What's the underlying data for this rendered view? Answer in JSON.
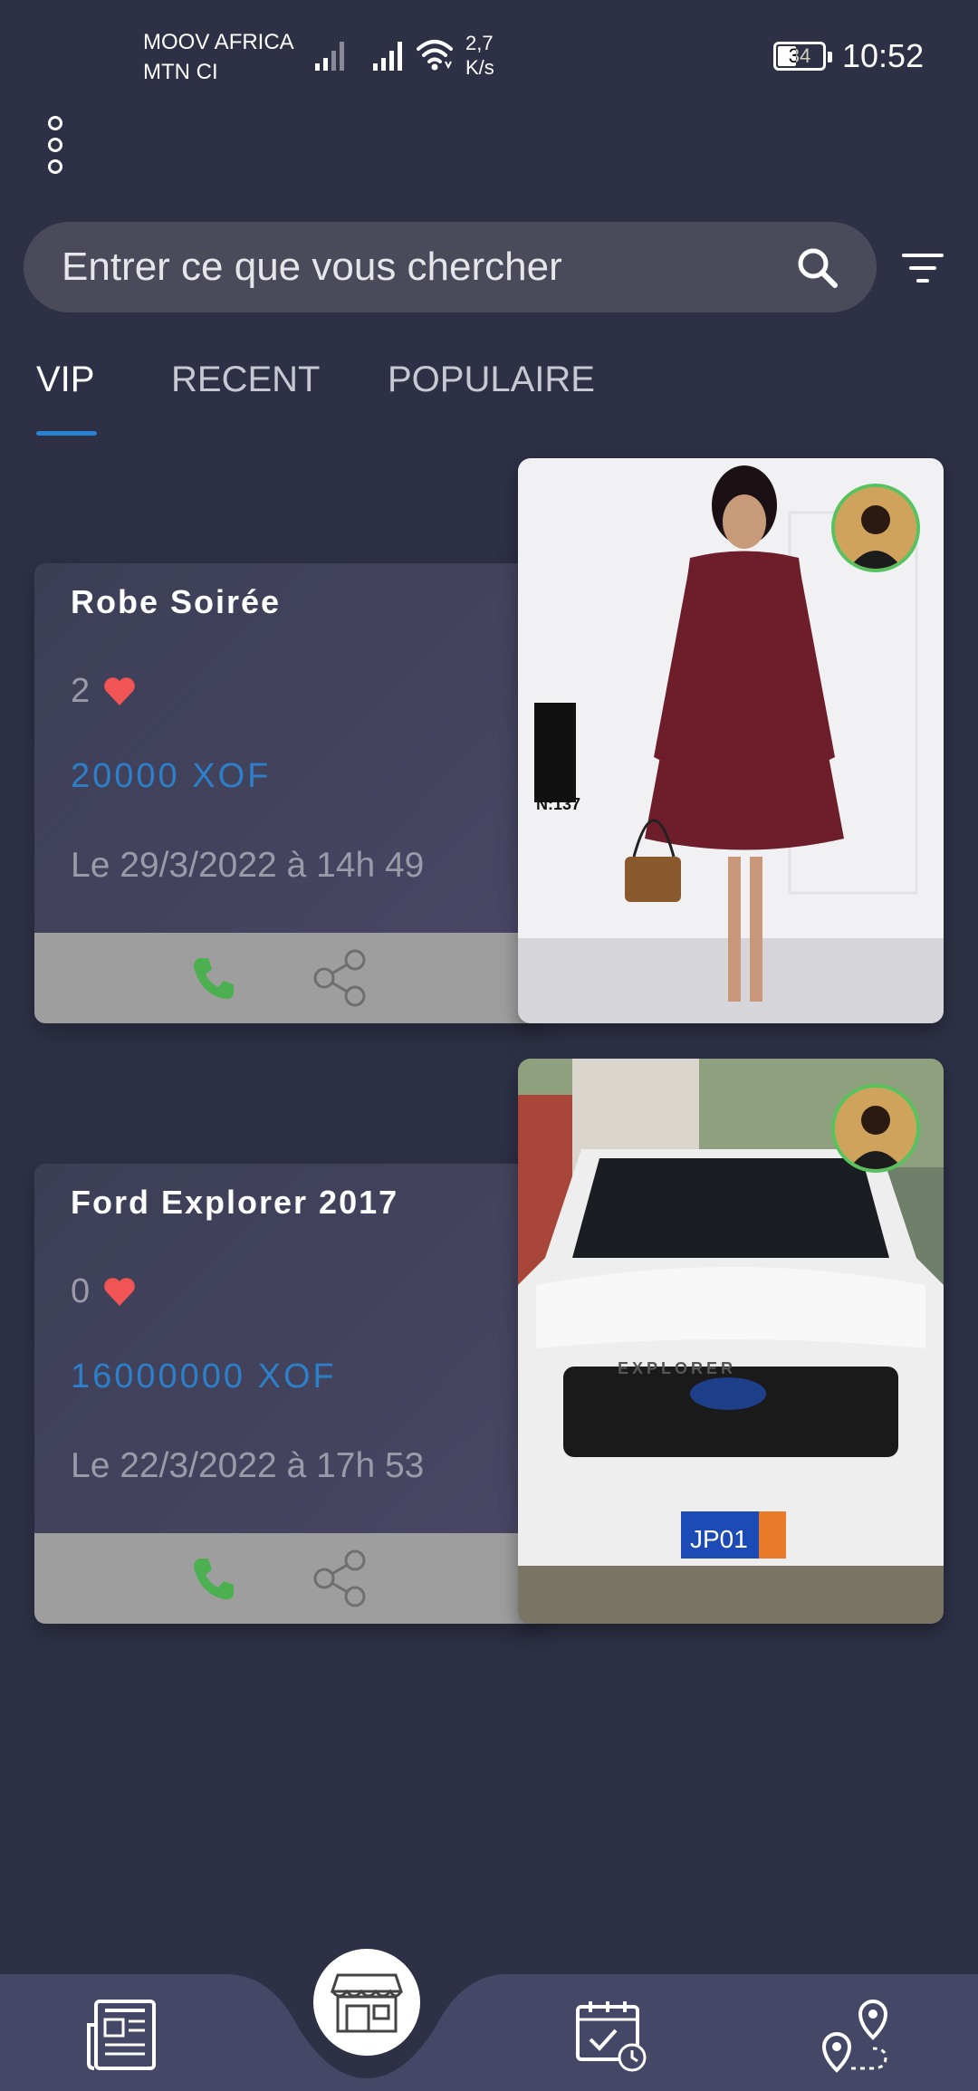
{
  "status_bar": {
    "carrier_1": "MOOV AFRICA",
    "carrier_2": "MTN CI",
    "speed_value": "2,7",
    "speed_unit": "K/s",
    "battery": "34",
    "time": "10:52"
  },
  "search": {
    "placeholder": "Entrer ce que vous chercher"
  },
  "tabs": [
    {
      "label": "VIP",
      "active": true
    },
    {
      "label": "RECENT",
      "active": false
    },
    {
      "label": "POPULAIRE",
      "active": false
    }
  ],
  "listings": [
    {
      "title": "Robe Soirée",
      "likes": "2",
      "price": "20000 XOF",
      "date": "Le 29/3/2022 à 14h 49",
      "image_label": "N:137"
    },
    {
      "title": "Ford Explorer 2017",
      "likes": "0",
      "price": "16000000 XOF",
      "date": "Le 22/3/2022 à 17h 53",
      "image_label": "EXPLORER",
      "plate": "JP01"
    }
  ],
  "colors": {
    "background": "#2e3046",
    "accent": "#2a82d4",
    "price": "#2c7fc8",
    "heart": "#f05454",
    "call": "#4caf50"
  },
  "bottom_nav": [
    "newspaper-icon",
    "store-icon",
    "calendar-check-icon",
    "route-map-icon"
  ]
}
